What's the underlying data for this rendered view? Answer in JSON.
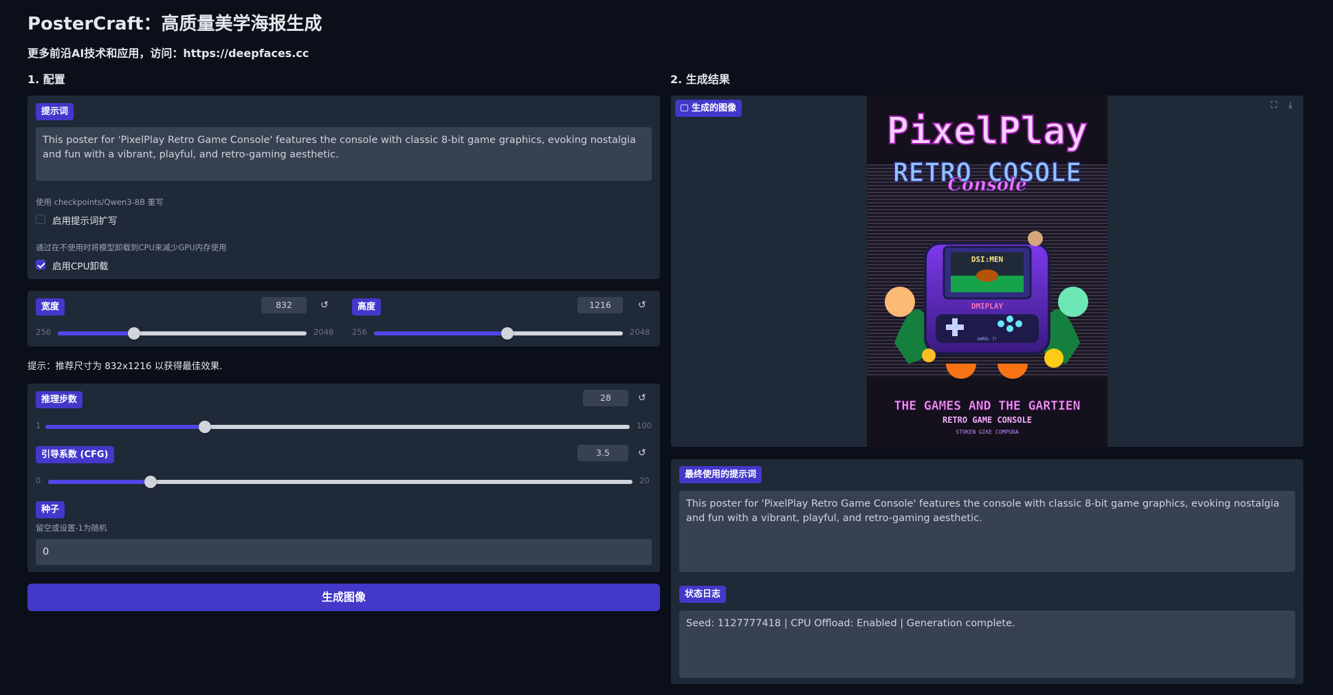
{
  "header": {
    "title": "PosterCraft：高质量美学海报生成",
    "subtitle": "更多前沿AI技术和应用，访问：https://deepfaces.cc"
  },
  "config": {
    "section_title": "1. 配置",
    "prompt": {
      "label": "提示词",
      "value": "This poster for 'PixelPlay Retro Game Console' features the console with classic 8-bit game graphics, evoking nostalgia and fun with a vibrant, playful, and retro-gaming aesthetic."
    },
    "rewrite": {
      "info": "使用 checkpoints/Qwen3-8B 重写",
      "label": "启用提示词扩写",
      "checked": false
    },
    "cpu_offload": {
      "info": "通过在不使用时将模型卸载到CPU来减少GPU内存使用",
      "label": "启用CPU卸载",
      "checked": true
    },
    "width": {
      "label": "宽度",
      "value": "832",
      "min": "256",
      "max": "2048",
      "fraction": 0.306
    },
    "height": {
      "label": "高度",
      "value": "1216",
      "min": "256",
      "max": "2048",
      "fraction": 0.536
    },
    "hint": "提示：推荐尺寸为 832x1216 以获得最佳效果.",
    "steps": {
      "label": "推理步数",
      "value": "28",
      "min": "1",
      "max": "100",
      "fraction": 0.273
    },
    "cfg": {
      "label": "引导系数 (CFG)",
      "value": "3.5",
      "min": "0",
      "max": "20",
      "fraction": 0.175
    },
    "seed": {
      "label": "种子",
      "info": "留空或设置-1为随机",
      "value": "0"
    },
    "reset_icon": "↺",
    "generate_label": "生成图像"
  },
  "result": {
    "section_title": "2. 生成结果",
    "image_label": "生成的图像",
    "final_prompt": {
      "label": "最终使用的提示词",
      "value": "This poster for 'PixelPlay Retro Game Console' features the console with classic 8-bit game graphics, evoking nostalgia and fun with a vibrant, playful, and retro-gaming aesthetic."
    },
    "status": {
      "label": "状态日志",
      "value": "Seed: 1127777418 | CPU Offload: Enabled | Generation complete."
    },
    "poster": {
      "title_line1": "PixelPlay",
      "title_line2": "RETRO COSOLE",
      "title_script": "Console",
      "screen_text": "DSI:MEN",
      "brand_text": "DMIPLAY",
      "small_text": "GAREL 7!",
      "tagline1": "THE GAMES AND THE GARTIEN",
      "tagline2": "RETRO GAME CONSOLE",
      "tagline3": "STOKEN GIKE COMPURA"
    }
  },
  "icons": {
    "image_icon": "image-icon",
    "fullscreen_icon": "fullscreen-icon",
    "download_icon": "download-icon"
  }
}
